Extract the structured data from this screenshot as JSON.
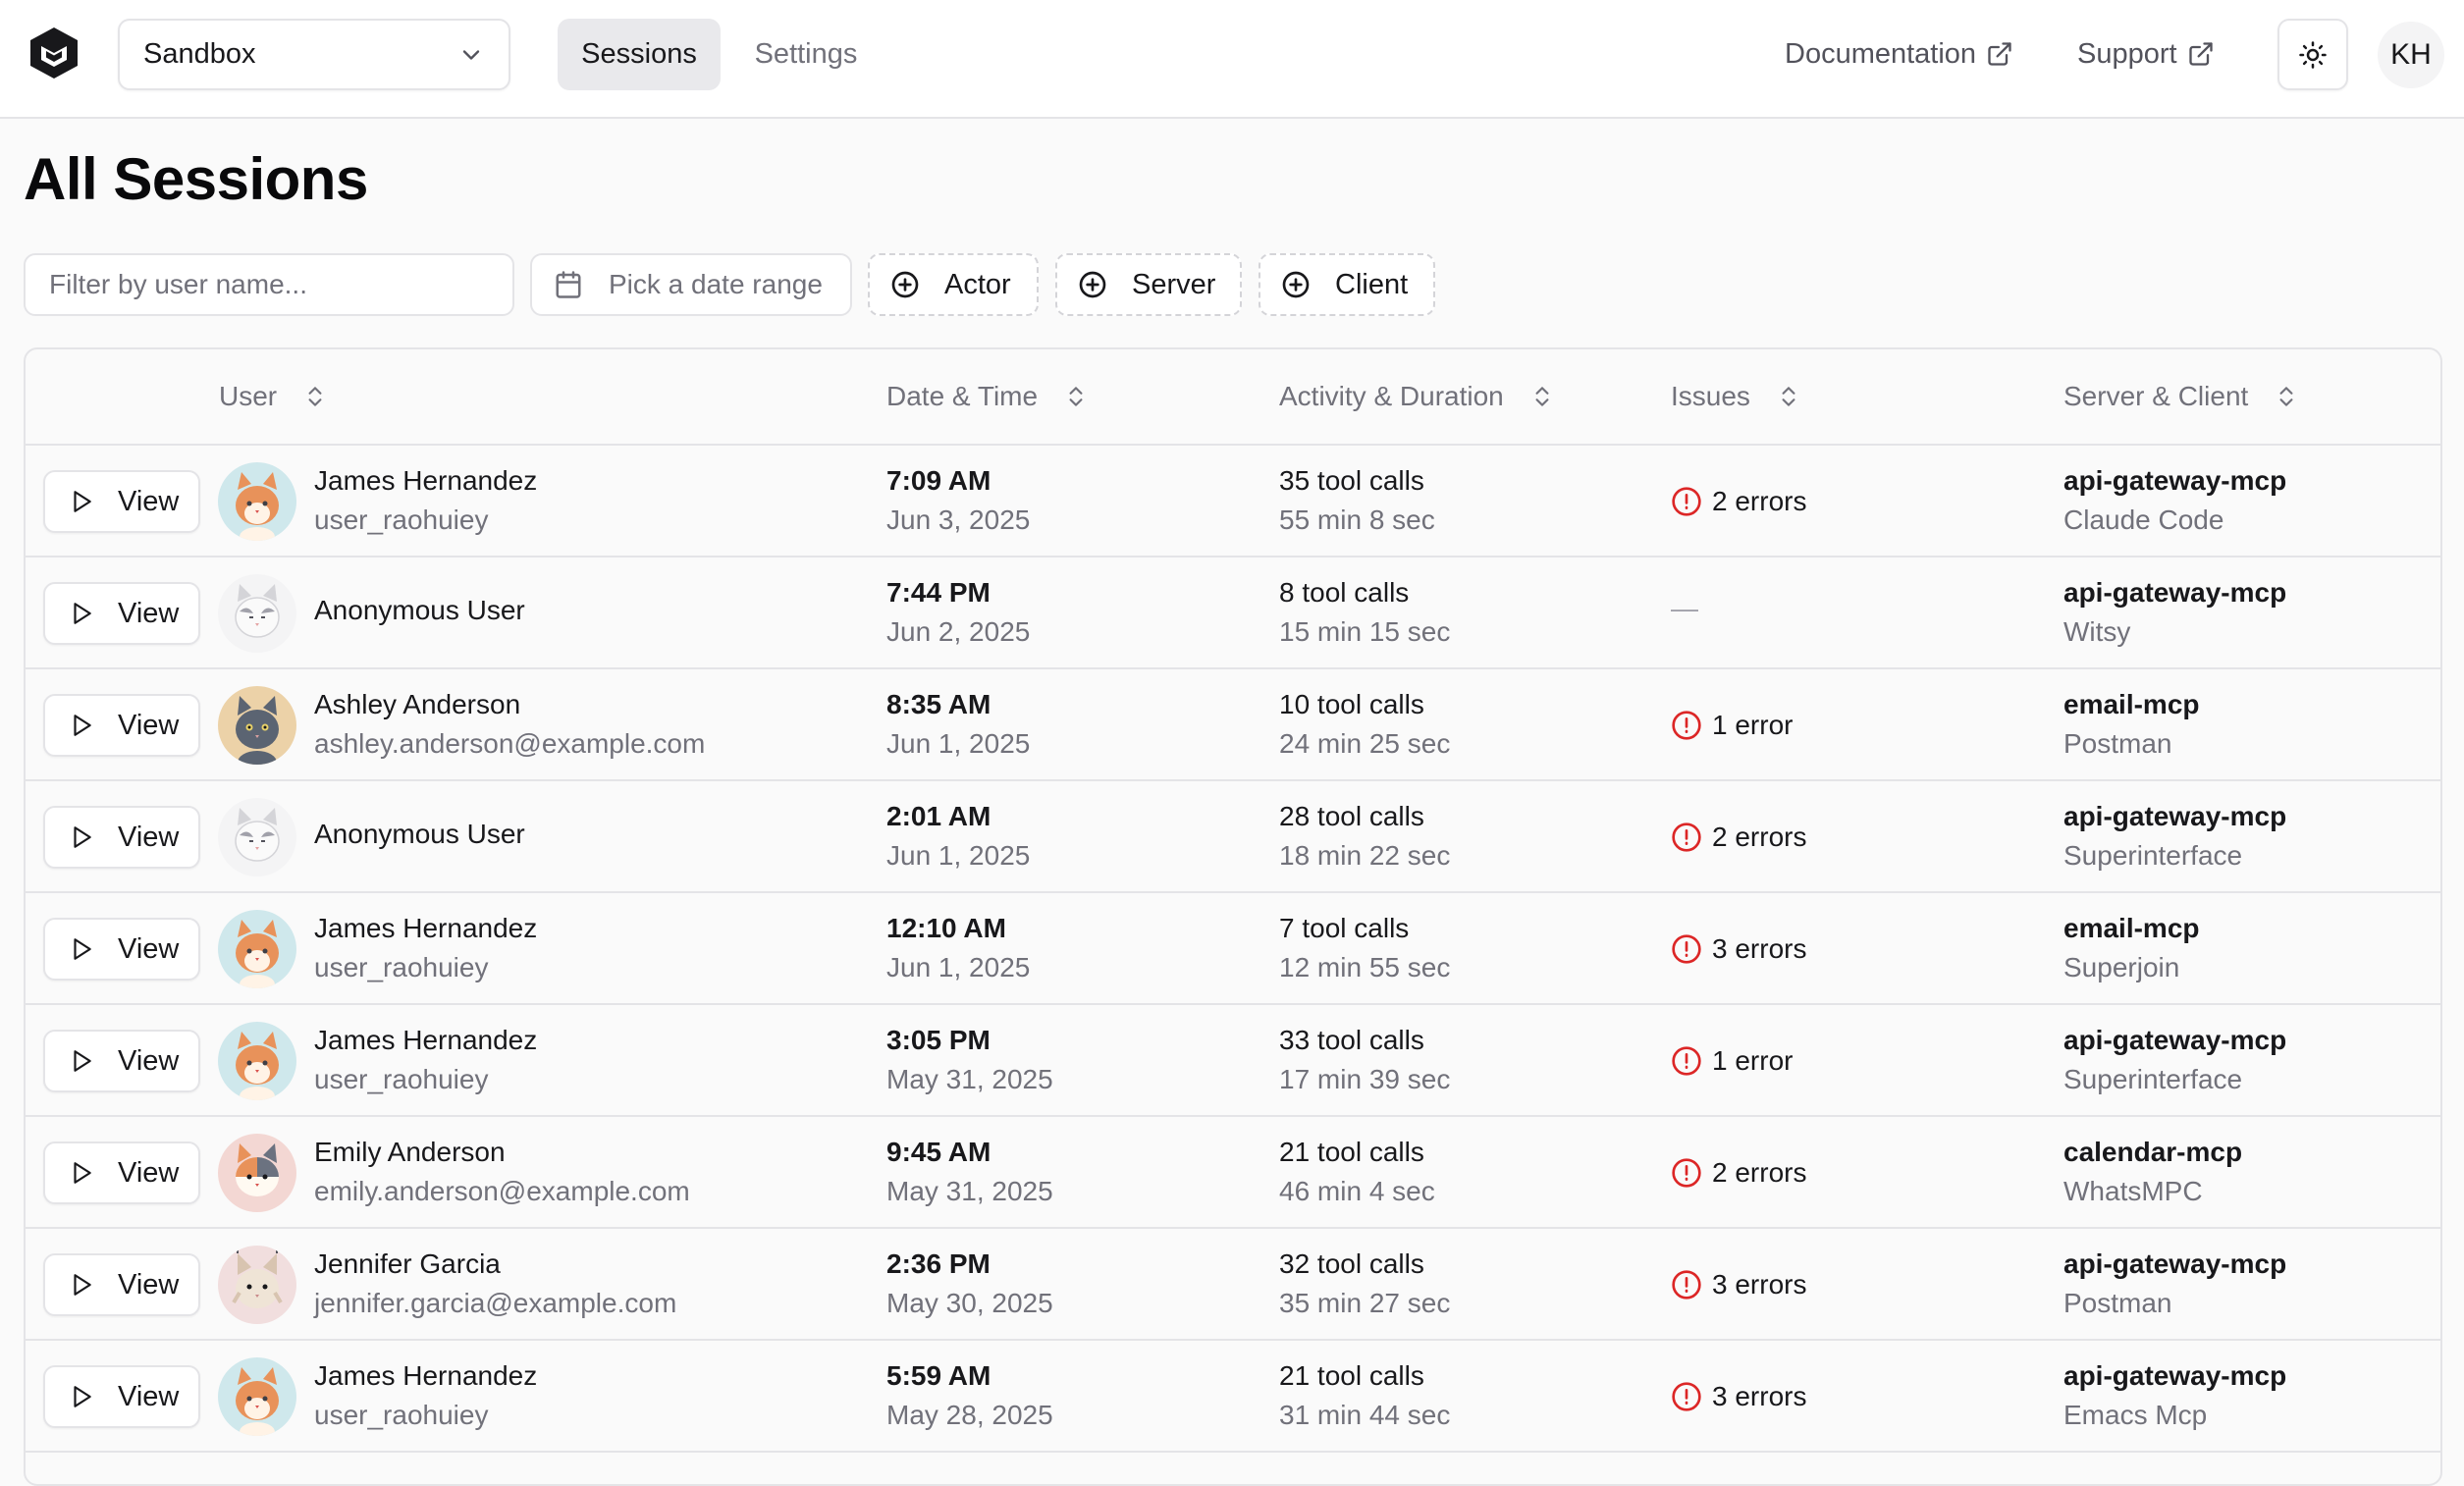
{
  "nav": {
    "workspace": "Sandbox",
    "tabs": [
      {
        "label": "Sessions",
        "active": true
      },
      {
        "label": "Settings",
        "active": false
      }
    ],
    "links": [
      {
        "label": "Documentation",
        "icon": "external-link-icon"
      },
      {
        "label": "Support",
        "icon": "external-link-icon"
      }
    ],
    "theme_icon": "sun-icon",
    "user_initials": "KH"
  },
  "page": {
    "title": "All Sessions"
  },
  "filters": {
    "search_placeholder": "Filter by user name...",
    "date_placeholder": "Pick a date range",
    "chips": [
      {
        "label": "Actor",
        "icon": "plus-circle-icon"
      },
      {
        "label": "Server",
        "icon": "plus-circle-icon"
      },
      {
        "label": "Client",
        "icon": "plus-circle-icon"
      }
    ]
  },
  "table": {
    "columns": [
      {
        "label": "User",
        "sortable": true
      },
      {
        "label": "Date & Time",
        "sortable": true
      },
      {
        "label": "Activity & Duration",
        "sortable": true
      },
      {
        "label": "Issues",
        "sortable": true
      },
      {
        "label": "Server & Client",
        "sortable": true
      }
    ],
    "view_label": "View",
    "rows": [
      {
        "avatar": "cat-orange",
        "name": "James Hernandez",
        "handle": "user_raohuiey",
        "time": "7:09 AM",
        "date": "Jun 3, 2025",
        "activity": "35 tool calls",
        "duration": "55 min 8 sec",
        "issues": "2 errors",
        "server": "api-gateway-mcp",
        "client": "Claude Code"
      },
      {
        "avatar": "cat-white",
        "name": "Anonymous User",
        "handle": "",
        "time": "7:44 PM",
        "date": "Jun 2, 2025",
        "activity": "8 tool calls",
        "duration": "15 min 15 sec",
        "issues": "—",
        "server": "api-gateway-mcp",
        "client": "Witsy"
      },
      {
        "avatar": "cat-gray",
        "name": "Ashley Anderson",
        "handle": "ashley.anderson@example.com",
        "time": "8:35 AM",
        "date": "Jun 1, 2025",
        "activity": "10 tool calls",
        "duration": "24 min 25 sec",
        "issues": "1 error",
        "server": "email-mcp",
        "client": "Postman"
      },
      {
        "avatar": "cat-white",
        "name": "Anonymous User",
        "handle": "",
        "time": "2:01 AM",
        "date": "Jun 1, 2025",
        "activity": "28 tool calls",
        "duration": "18 min 22 sec",
        "issues": "2 errors",
        "server": "api-gateway-mcp",
        "client": "Superinterface"
      },
      {
        "avatar": "cat-orange",
        "name": "James Hernandez",
        "handle": "user_raohuiey",
        "time": "12:10 AM",
        "date": "Jun 1, 2025",
        "activity": "7 tool calls",
        "duration": "12 min 55 sec",
        "issues": "3 errors",
        "server": "email-mcp",
        "client": "Superjoin"
      },
      {
        "avatar": "cat-orange",
        "name": "James Hernandez",
        "handle": "user_raohuiey",
        "time": "3:05 PM",
        "date": "May 31, 2025",
        "activity": "33 tool calls",
        "duration": "17 min 39 sec",
        "issues": "1 error",
        "server": "api-gateway-mcp",
        "client": "Superinterface"
      },
      {
        "avatar": "cat-calico",
        "name": "Emily Anderson",
        "handle": "emily.anderson@example.com",
        "time": "9:45 AM",
        "date": "May 31, 2025",
        "activity": "21 tool calls",
        "duration": "46 min 4 sec",
        "issues": "2 errors",
        "server": "calendar-mcp",
        "client": "WhatsMPC"
      },
      {
        "avatar": "cat-lynx",
        "name": "Jennifer Garcia",
        "handle": "jennifer.garcia@example.com",
        "time": "2:36 PM",
        "date": "May 30, 2025",
        "activity": "32 tool calls",
        "duration": "35 min 27 sec",
        "issues": "3 errors",
        "server": "api-gateway-mcp",
        "client": "Postman"
      },
      {
        "avatar": "cat-orange",
        "name": "James Hernandez",
        "handle": "user_raohuiey",
        "time": "5:59 AM",
        "date": "May 28, 2025",
        "activity": "21 tool calls",
        "duration": "31 min 44 sec",
        "issues": "3 errors",
        "server": "api-gateway-mcp",
        "client": "Emacs Mcp"
      }
    ]
  },
  "colors": {
    "error": "#dc2626",
    "muted_text": "#71717a",
    "border": "#e4e4e7",
    "active_tab_bg": "#e9e9ec"
  }
}
